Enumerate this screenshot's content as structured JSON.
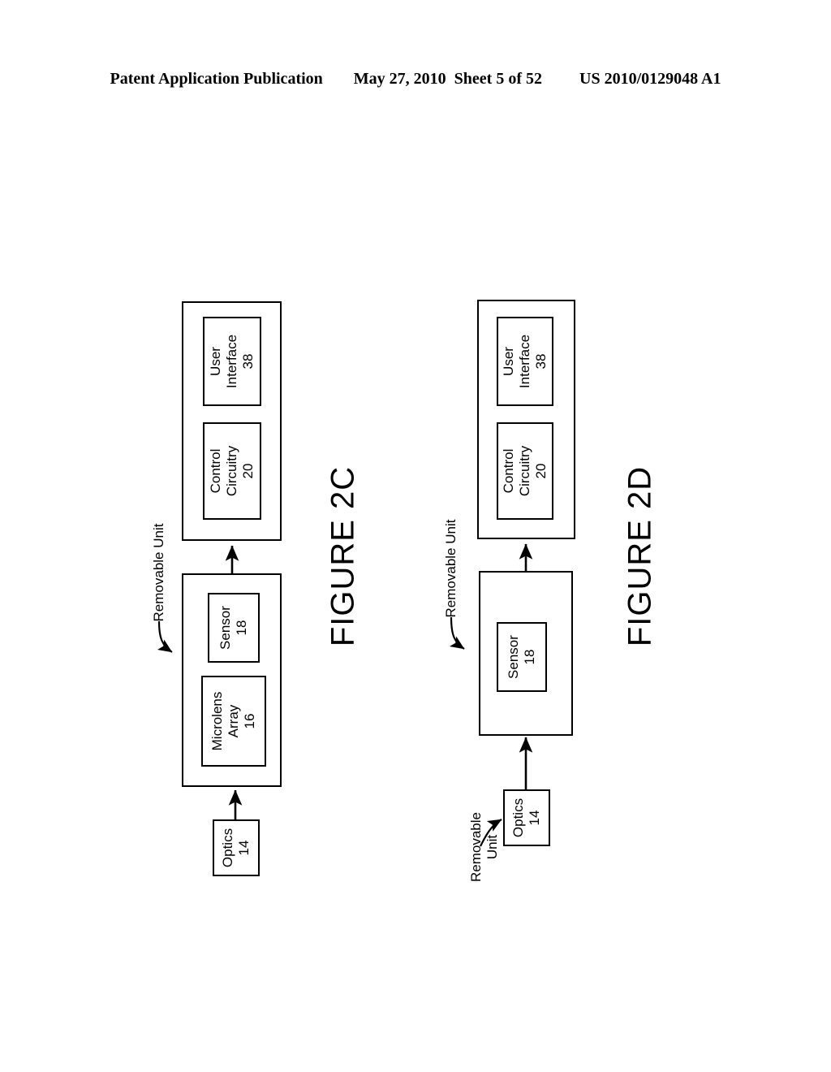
{
  "header": {
    "publication": "Patent Application Publication",
    "date": "May 27, 2010",
    "sheet": "Sheet 5 of 52",
    "patent_number": "US 2010/0129048 A1"
  },
  "figures": [
    {
      "id": "figure-2c",
      "caption": "FIGURE 2C",
      "annotation": "Removable Unit",
      "annotation_lines": [
        "Removable Unit"
      ],
      "boxes": [
        {
          "id": "2c-body-unit",
          "kind": "outer",
          "label": ""
        },
        {
          "id": "2c-user-interface",
          "kind": "inner",
          "label": "User\nInterface\n38",
          "lines": [
            "User",
            "Interface",
            "38"
          ]
        },
        {
          "id": "2c-control-circuitry",
          "kind": "inner",
          "label": "Control\nCircuitry\n20",
          "lines": [
            "Control",
            "Circuitry",
            "20"
          ]
        },
        {
          "id": "2c-removable-unit",
          "kind": "outer",
          "label": ""
        },
        {
          "id": "2c-sensor",
          "kind": "inner",
          "label": "Sensor\n18",
          "lines": [
            "Sensor",
            "18"
          ]
        },
        {
          "id": "2c-microlens-array",
          "kind": "inner",
          "label": "Microlens\nArray\n16",
          "lines": [
            "Microlens",
            "Array",
            "16"
          ]
        },
        {
          "id": "2c-optics",
          "kind": "inner",
          "label": "Optics\n14",
          "lines": [
            "Optics",
            "14"
          ]
        }
      ]
    },
    {
      "id": "figure-2d",
      "caption": "FIGURE 2D",
      "annotation": "Removable Unit",
      "annotation_lines": [
        "Removable",
        "Unit"
      ],
      "boxes": [
        {
          "id": "2d-body-unit",
          "kind": "outer",
          "label": ""
        },
        {
          "id": "2d-user-interface",
          "kind": "inner",
          "label": "User\nInterface\n38",
          "lines": [
            "User",
            "Interface",
            "38"
          ]
        },
        {
          "id": "2d-control-circuitry",
          "kind": "inner",
          "label": "Control\nCircuitry\n20",
          "lines": [
            "Control",
            "Circuitry",
            "20"
          ]
        },
        {
          "id": "2d-camera-body",
          "kind": "outer",
          "label": ""
        },
        {
          "id": "2d-sensor",
          "kind": "inner",
          "label": "Sensor\n18",
          "lines": [
            "Sensor",
            "18"
          ]
        },
        {
          "id": "2d-optics",
          "kind": "inner",
          "label": "Optics\n14",
          "lines": [
            "Optics",
            "14"
          ]
        }
      ]
    }
  ],
  "labels": {
    "user_interface": "User\nInterface\n38",
    "user_interface_l1": "User",
    "user_interface_l2": "Interface",
    "user_interface_ref": "38",
    "control_circuitry_l1": "Control",
    "control_circuitry_l2": "Circuitry",
    "control_circuitry_ref": "20",
    "sensor_l1": "Sensor",
    "sensor_ref": "18",
    "microlens_l1": "Microlens",
    "microlens_l2": "Array",
    "microlens_ref": "16",
    "optics_l1": "Optics",
    "optics_ref": "14",
    "removable_unit": "Removable Unit",
    "removable_l1": "Removable",
    "removable_l2": "Unit",
    "figure_2c": "FIGURE 2C",
    "figure_2d": "FIGURE 2D"
  },
  "colors": {
    "ink": "#000000",
    "paper": "#ffffff"
  }
}
